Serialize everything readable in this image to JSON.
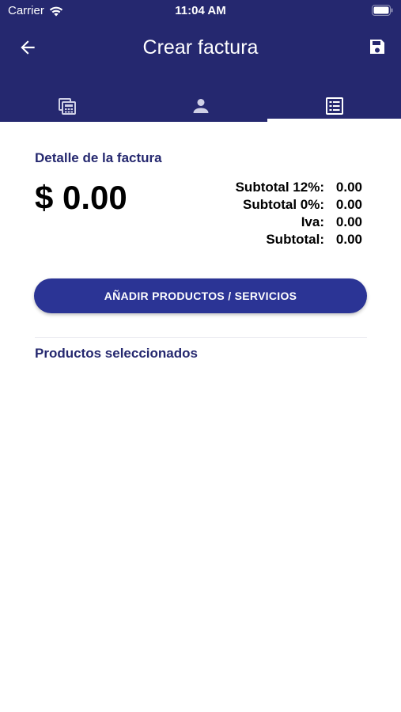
{
  "status_bar": {
    "carrier": "Carrier",
    "time": "11:04 AM"
  },
  "nav": {
    "title": "Crear factura",
    "back_icon": "arrow-left-icon",
    "save_icon": "floppy-disk-icon"
  },
  "tabs": [
    {
      "icon": "calculator-icon",
      "active": false
    },
    {
      "icon": "person-icon",
      "active": false
    },
    {
      "icon": "list-icon",
      "active": true
    }
  ],
  "detail": {
    "title": "Detalle de la factura",
    "total": "$ 0.00",
    "summary": [
      {
        "label": "Subtotal 12%:",
        "value": "0.00"
      },
      {
        "label": "Subtotal 0%:",
        "value": "0.00"
      },
      {
        "label": "Iva:",
        "value": "0.00"
      },
      {
        "label": "Subtotal:",
        "value": "0.00"
      }
    ]
  },
  "add_button": {
    "label": "AÑADIR PRODUCTOS / SERVICIOS"
  },
  "selected": {
    "title": "Productos seleccionados"
  },
  "colors": {
    "header": "#25286f",
    "button": "#2b3495",
    "accent_text": "#25286f"
  }
}
